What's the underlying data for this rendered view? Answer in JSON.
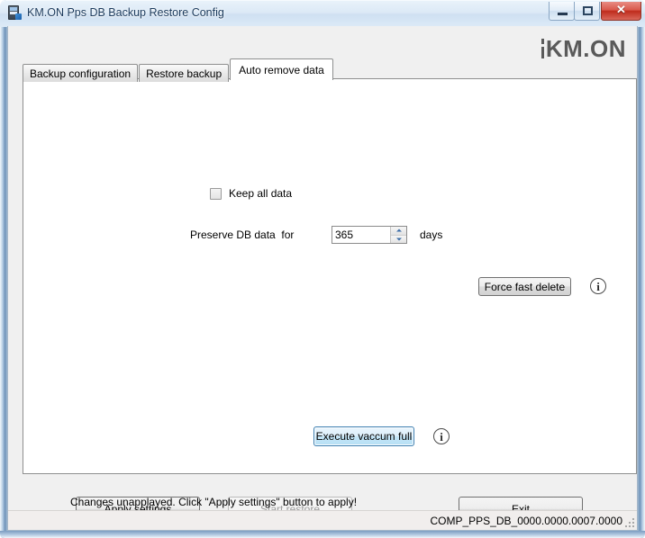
{
  "window": {
    "title": "KM.ON Pps DB Backup Restore Config",
    "icon": "database-app-icon",
    "controls": {
      "minimize": "minimize-icon",
      "restore": "restore-icon",
      "close": "✕"
    }
  },
  "brand": {
    "logo_text": "KM.ON",
    "logo_prefix": "K",
    "logo_rest": "M.ON",
    "logo_color": "#5a5a5a"
  },
  "tabs": [
    {
      "label": "Backup configuration",
      "active": false
    },
    {
      "label": "Restore backup",
      "active": false
    },
    {
      "label": "Auto remove data",
      "active": true
    }
  ],
  "panel": {
    "keep_all_data": {
      "label": "Keep all data",
      "checked": false
    },
    "preserve": {
      "label": "Preserve DB data  for",
      "value": "365",
      "placeholder": "",
      "unit_label": "days"
    },
    "force_fast_delete_label": "Force fast delete",
    "force_fast_delete_info": "i",
    "execute_vaccum_full_label": "Execute vaccum full",
    "execute_vaccum_full_info": "i",
    "status_message": "Changes unapplayed. Click \"Apply settings\" button to apply!"
  },
  "footer": {
    "apply_settings_label": "Apply settings",
    "start_restore_label": "Start restore",
    "start_restore_enabled": false,
    "exit_label": "Exit"
  },
  "statusbar": {
    "version": "COMP_PPS_DB_0000.0000.0007.0000",
    "grip": "resize-grip-icon"
  }
}
